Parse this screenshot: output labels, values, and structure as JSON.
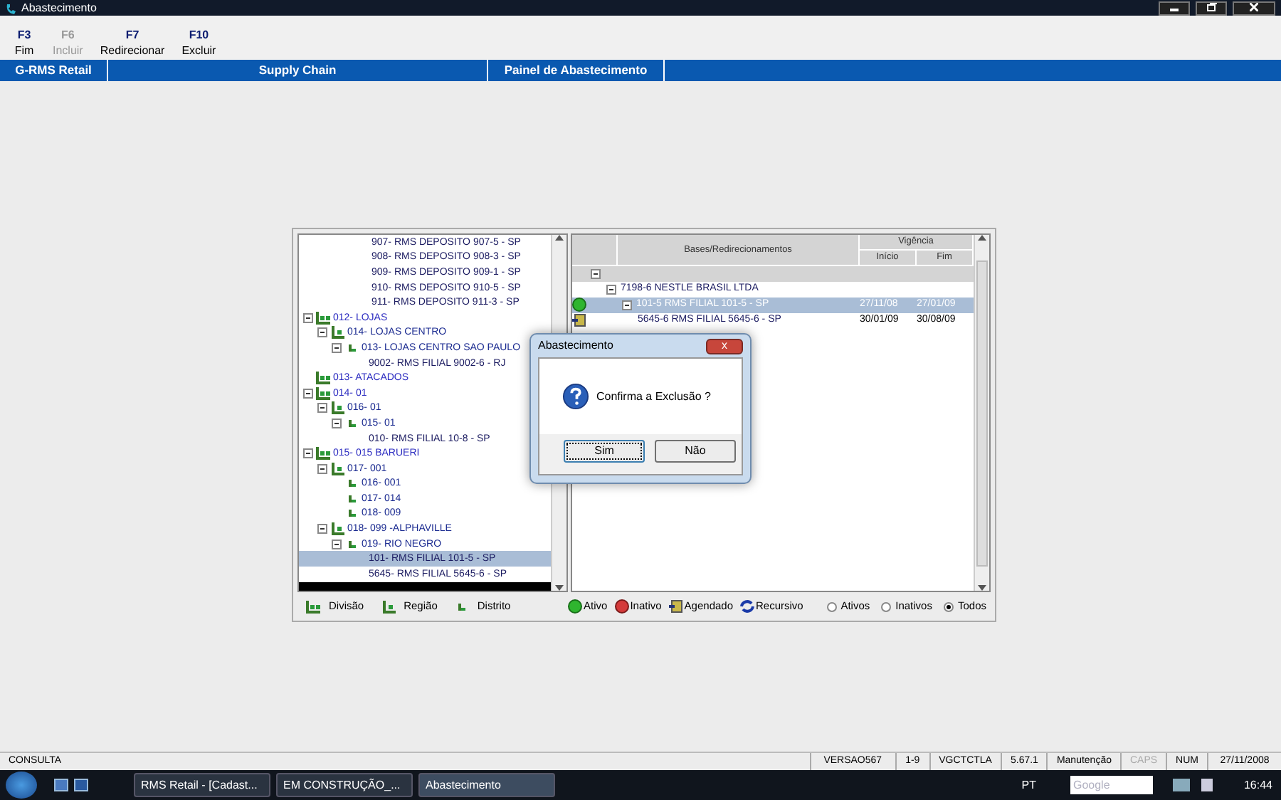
{
  "window": {
    "title": "Abastecimento"
  },
  "toolbar": [
    {
      "key": "F3",
      "label": "Fim",
      "disabled": false
    },
    {
      "key": "F6",
      "label": "Incluir",
      "disabled": true
    },
    {
      "key": "F7",
      "label": "Redirecionar",
      "disabled": false
    },
    {
      "key": "F10",
      "label": "Excluir",
      "disabled": false
    }
  ],
  "header_tabs": [
    "G-RMS Retail",
    "Supply Chain",
    "Painel de Abastecimento"
  ],
  "tree": [
    {
      "label": "907- RMS DEPOSITO 907-5 - SP",
      "kind": "filial",
      "selected": false
    },
    {
      "label": "908- RMS DEPOSITO 908-3 - SP",
      "kind": "filial",
      "selected": false
    },
    {
      "label": "909- RMS DEPOSITO 909-1 - SP",
      "kind": "filial",
      "selected": false
    },
    {
      "label": "910- RMS DEPOSITO 910-5 - SP",
      "kind": "filial",
      "selected": false
    },
    {
      "label": "911- RMS DEPOSITO 911-3 - SP",
      "kind": "filial",
      "selected": false
    },
    {
      "label": "012- LOJAS",
      "kind": "divisao",
      "selected": false,
      "children": [
        {
          "label": "014- LOJAS CENTRO",
          "kind": "regiao",
          "selected": false,
          "children": [
            {
              "label": "013- LOJAS CENTRO SAO PAULO",
              "kind": "distrito",
              "selected": false,
              "children": [
                {
                  "label": "9002- RMS FILIAL 9002-6 - RJ",
                  "kind": "filial",
                  "selected": false
                }
              ]
            }
          ]
        }
      ]
    },
    {
      "label": "013- ATACADOS",
      "kind": "divisao",
      "selected": false
    },
    {
      "label": "014- 01",
      "kind": "divisao",
      "selected": false,
      "children": [
        {
          "label": "016- 01",
          "kind": "regiao",
          "selected": false,
          "children": [
            {
              "label": "015- 01",
              "kind": "distrito",
              "selected": false,
              "children": [
                {
                  "label": "010- RMS FILIAL 10-8 - SP",
                  "kind": "filial",
                  "selected": false
                }
              ]
            }
          ]
        }
      ]
    },
    {
      "label": "015- 015 BARUERI",
      "kind": "divisao",
      "selected": false,
      "children": [
        {
          "label": "017- 001",
          "kind": "regiao",
          "selected": false,
          "children": [
            {
              "label": "016- 001",
              "kind": "distrito",
              "selected": false
            },
            {
              "label": "017- 014",
              "kind": "distrito",
              "selected": false
            },
            {
              "label": "018- 009",
              "kind": "distrito",
              "selected": false
            }
          ]
        },
        {
          "label": "018- 099 -ALPHAVILLE",
          "kind": "regiao",
          "selected": false,
          "children": [
            {
              "label": "019- RIO NEGRO",
              "kind": "distrito",
              "selected": false,
              "children": [
                {
                  "label": "101- RMS FILIAL 101-5 - SP",
                  "kind": "filial",
                  "selected": true
                },
                {
                  "label": "5645- RMS FILIAL 5645-6 - SP",
                  "kind": "filial",
                  "selected": false
                }
              ]
            }
          ]
        }
      ]
    }
  ],
  "tree_legend": [
    {
      "label": "Divisão",
      "kind": "divisao"
    },
    {
      "label": "Região",
      "kind": "regiao"
    },
    {
      "label": "Distrito",
      "kind": "distrito"
    }
  ],
  "grid": {
    "columns": {
      "bases": "Bases/Redirecionamentos",
      "vigencia": "Vigência",
      "inicio": "Início",
      "fim": "Fim"
    },
    "rows": [
      {
        "kind": "root",
        "selected": false,
        "children": [
          {
            "label": "7198-6 NESTLE BRASIL LTDA",
            "selected": false,
            "children": [
              {
                "label": "101-5 RMS FILIAL 101-5 - SP",
                "kind": "ativo",
                "inicio": "27/11/08",
                "fim": "27/01/09",
                "selected": true,
                "children": [
                  {
                    "label": "5645-6 RMS FILIAL 5645-6 - SP",
                    "kind": "agendado",
                    "inicio": "30/01/09",
                    "fim": "30/08/09",
                    "selected": false
                  }
                ]
              }
            ]
          }
        ]
      }
    ]
  },
  "status_legend": [
    {
      "label": "Ativo",
      "kind": "ativo"
    },
    {
      "label": "Inativo",
      "kind": "inativo"
    },
    {
      "label": "Agendado",
      "kind": "agendado"
    },
    {
      "label": "Recursivo",
      "kind": "recursivo"
    }
  ],
  "filter": [
    {
      "label": "Ativos",
      "selected": false
    },
    {
      "label": "Inativos",
      "selected": false
    },
    {
      "label": "Todos",
      "selected": true
    }
  ],
  "dialog": {
    "title": "Abastecimento",
    "close": "x",
    "message": "Confirma a Exclusão ?",
    "buttons": [
      {
        "label": "Sim",
        "default": true
      },
      {
        "label": "Não",
        "default": false
      }
    ]
  },
  "status_bar": {
    "mode": "CONSULTA",
    "cells": [
      {
        "text": "VERSAO567",
        "disabled": false
      },
      {
        "text": "1-9",
        "disabled": false
      },
      {
        "text": "VGCTCTLA",
        "disabled": false
      },
      {
        "text": "5.67.1",
        "disabled": false
      },
      {
        "text": "Manutenção",
        "disabled": false
      },
      {
        "text": "CAPS",
        "disabled": true
      },
      {
        "text": "NUM",
        "disabled": false
      },
      {
        "text": "27/11/2008",
        "disabled": false
      }
    ]
  },
  "taskbar": {
    "items": [
      {
        "label": "RMS Retail - [Cadast...",
        "selected": false
      },
      {
        "label": "EM CONSTRUÇÃO_...",
        "selected": false
      },
      {
        "label": "Abastecimento",
        "selected": true
      }
    ],
    "language": "PT",
    "search_placeholder": "Google",
    "clock": "16:44"
  }
}
